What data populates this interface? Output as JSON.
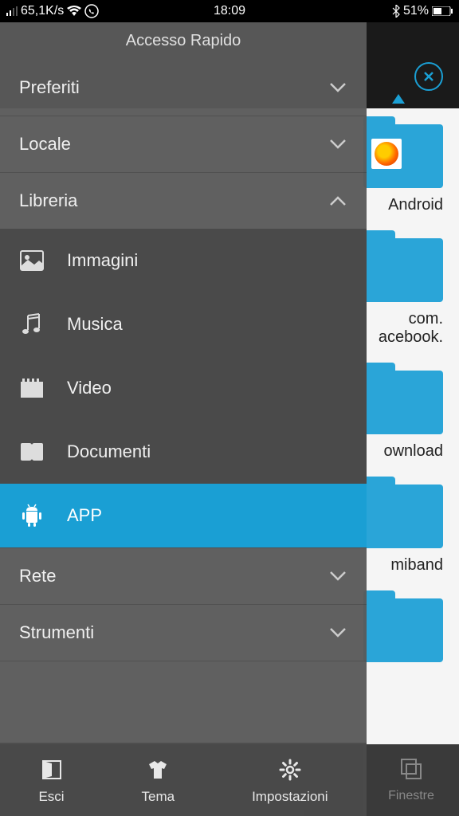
{
  "status_bar": {
    "speed": "65,1K/s",
    "time": "18:09",
    "battery": "51%"
  },
  "drawer": {
    "title": "Accesso Rapido",
    "sections": {
      "preferiti": {
        "label": "Preferiti",
        "expanded": false
      },
      "locale": {
        "label": "Locale",
        "expanded": false
      },
      "libreria": {
        "label": "Libreria",
        "expanded": true,
        "items": [
          {
            "label": "Immagini",
            "icon": "image-icon",
            "selected": false
          },
          {
            "label": "Musica",
            "icon": "music-icon",
            "selected": false
          },
          {
            "label": "Video",
            "icon": "video-icon",
            "selected": false
          },
          {
            "label": "Documenti",
            "icon": "document-icon",
            "selected": false
          },
          {
            "label": "APP",
            "icon": "android-icon",
            "selected": true
          }
        ]
      },
      "rete": {
        "label": "Rete",
        "expanded": false
      },
      "strumenti": {
        "label": "Strumenti",
        "expanded": false
      }
    },
    "bottom": [
      {
        "label": "Esci",
        "icon": "exit-icon"
      },
      {
        "label": "Tema",
        "icon": "theme-icon"
      },
      {
        "label": "Impostazioni",
        "icon": "settings-icon"
      }
    ]
  },
  "background": {
    "folders": [
      {
        "label": "Android"
      },
      {
        "label": "com.\nacebook."
      },
      {
        "label": "ownload"
      },
      {
        "label": "miband"
      }
    ],
    "bottom_nav": {
      "label": "Finestre"
    }
  },
  "colors": {
    "accent": "#1a9fd4",
    "folder": "#2aa5d8"
  }
}
